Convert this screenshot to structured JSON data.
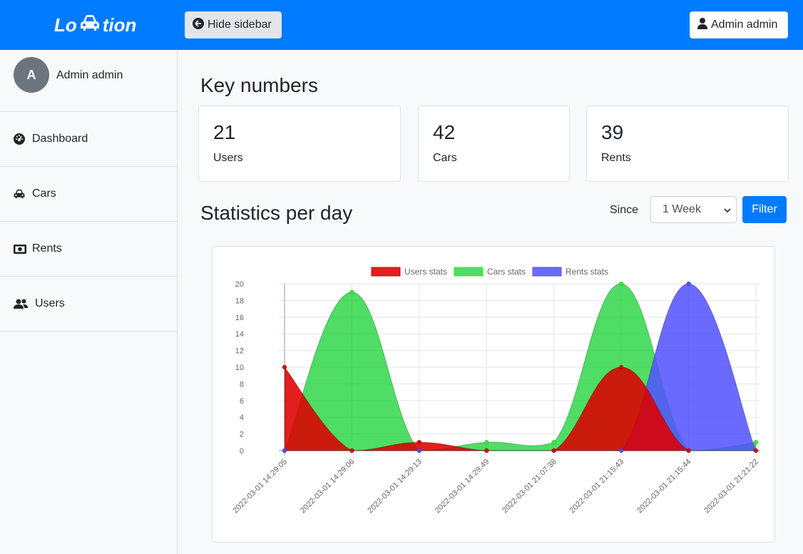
{
  "header": {
    "brand_left": "Lo",
    "brand_right": "tion",
    "hide_sidebar": "Hide sidebar",
    "user_button": "Admin admin"
  },
  "sidebar": {
    "avatar_initial": "A",
    "profile_name": "Admin admin",
    "items": [
      {
        "label": "Dashboard",
        "icon": "tachometer-icon"
      },
      {
        "label": "Cars",
        "icon": "car-icon"
      },
      {
        "label": "Rents",
        "icon": "money-bill-icon"
      },
      {
        "label": "Users",
        "icon": "users-icon"
      }
    ]
  },
  "main": {
    "key_title": "Key numbers",
    "cards": [
      {
        "value": "21",
        "label": "Users"
      },
      {
        "value": "42",
        "label": "Cars"
      },
      {
        "value": "39",
        "label": "Rents"
      }
    ],
    "stats_title": "Statistics per day",
    "since_label": "Since",
    "since_value": "1 Week",
    "filter_label": "Filter"
  },
  "colors": {
    "primary": "#007bff",
    "users": "#dd0000",
    "cars": "#33ee33",
    "rents": "#5050ff"
  },
  "chart_data": {
    "type": "area",
    "x": [
      "2022-03-01 14:29:05",
      "2022-03-01 14:29:06",
      "2022-03-01 14:29:13",
      "2022-03-01 14:29:49",
      "2022-03-01 21:07:38",
      "2022-03-01 21:15:43",
      "2022-03-01 21:15:44",
      "2022-03-01 21:21:22"
    ],
    "series": [
      {
        "name": "Users stats",
        "values": [
          10,
          0,
          1,
          0,
          0,
          10,
          0,
          0
        ],
        "color": "#dd0000"
      },
      {
        "name": "Cars stats",
        "values": [
          0,
          19,
          0,
          1,
          1,
          20,
          0,
          1
        ],
        "color": "#33ee33"
      },
      {
        "name": "Rents stats",
        "values": [
          0,
          0,
          0,
          0,
          0,
          0,
          20,
          0
        ],
        "color": "#5050ff"
      }
    ],
    "ylim": [
      0,
      20
    ],
    "yticks": [
      0,
      2,
      4,
      6,
      8,
      10,
      12,
      14,
      16,
      18,
      20
    ],
    "grid": true,
    "legend": "top"
  }
}
